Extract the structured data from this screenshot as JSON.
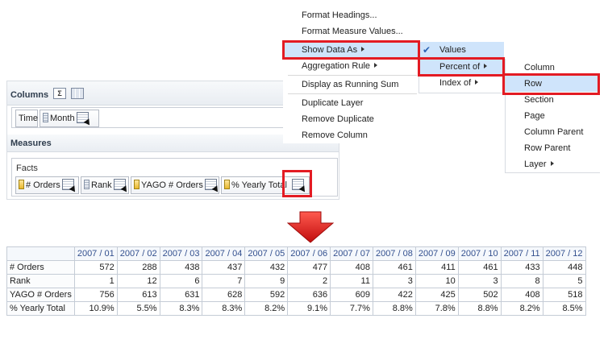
{
  "layout_panel": {
    "columns_title": "Columns",
    "sum_icon_glyph": "Σ",
    "columns_items": [
      {
        "label": "Time",
        "icon": "none"
      },
      {
        "label": "Month",
        "icon": "column-icon"
      }
    ],
    "measures_title": "Measures",
    "facts_label": "Facts",
    "measure_items": [
      {
        "label": "# Orders"
      },
      {
        "label": "Rank"
      },
      {
        "label": "YAGO # Orders"
      },
      {
        "label": "% Yearly Total"
      }
    ]
  },
  "context_menu": {
    "items": [
      "Format Headings...",
      "Format Measure Values...",
      "Show Data As",
      "Aggregation Rule",
      "Display as Running Sum",
      "Duplicate Layer",
      "Remove Duplicate",
      "Remove Column"
    ]
  },
  "show_data_as_menu": {
    "items": [
      "Values",
      "Percent of",
      "Index of"
    ]
  },
  "percent_of_menu": {
    "items": [
      "Column",
      "Row",
      "Section",
      "Page",
      "Column Parent",
      "Row Parent",
      "Layer"
    ]
  },
  "colors": {
    "highlight_red": "#e31b23",
    "menu_hover": "#cfe4fb",
    "header_text": "#33508f"
  },
  "result_table": {
    "columns": [
      "2007 / 01",
      "2007 / 02",
      "2007 / 03",
      "2007 / 04",
      "2007 / 05",
      "2007 / 06",
      "2007 / 07",
      "2007 / 08",
      "2007 / 09",
      "2007 / 10",
      "2007 / 11",
      "2007 / 12"
    ],
    "rows": [
      {
        "label": "# Orders",
        "values": [
          "572",
          "288",
          "438",
          "437",
          "432",
          "477",
          "408",
          "461",
          "411",
          "461",
          "433",
          "448"
        ]
      },
      {
        "label": "Rank",
        "values": [
          "1",
          "12",
          "6",
          "7",
          "9",
          "2",
          "11",
          "3",
          "10",
          "3",
          "8",
          "5"
        ]
      },
      {
        "label": "YAGO # Orders",
        "values": [
          "756",
          "613",
          "631",
          "628",
          "592",
          "636",
          "609",
          "422",
          "425",
          "502",
          "408",
          "518"
        ]
      },
      {
        "label": "% Yearly Total",
        "values": [
          "10.9%",
          "5.5%",
          "8.3%",
          "8.3%",
          "8.2%",
          "9.1%",
          "7.7%",
          "8.8%",
          "7.8%",
          "8.8%",
          "8.2%",
          "8.5%"
        ]
      }
    ]
  }
}
